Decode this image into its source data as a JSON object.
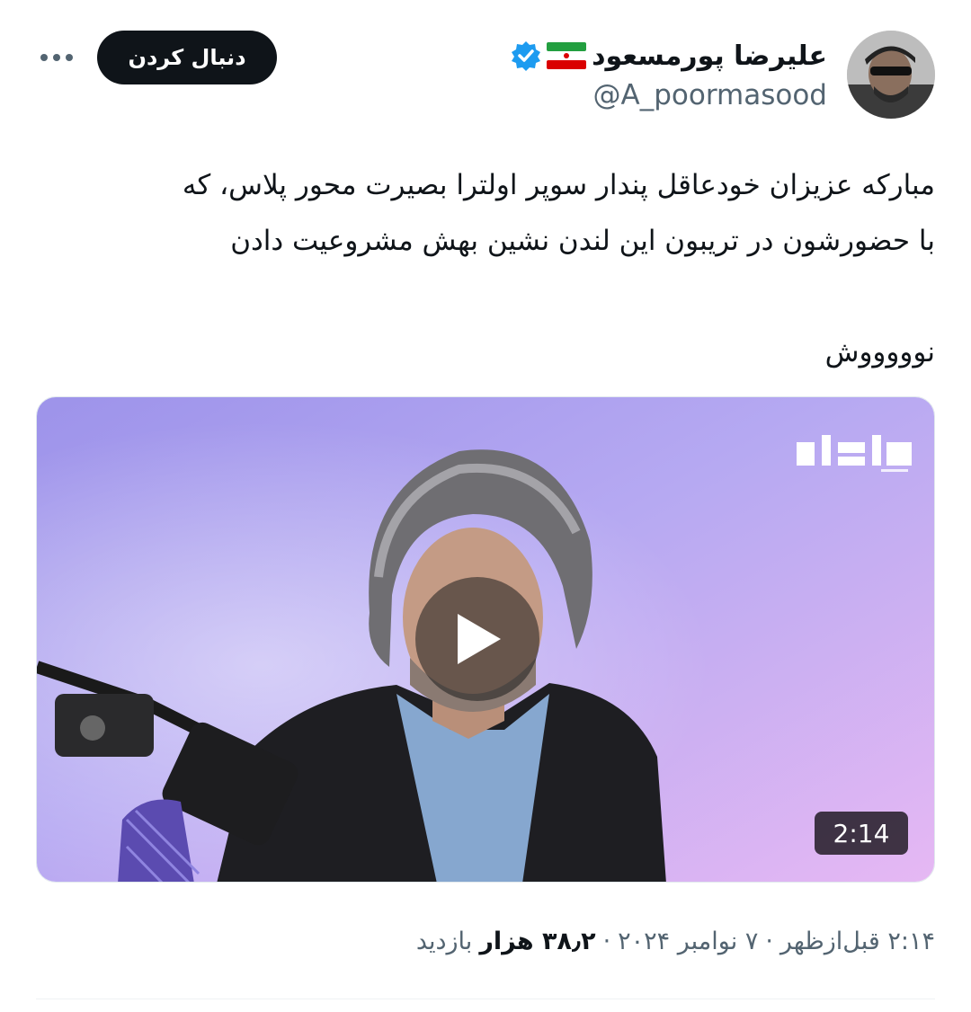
{
  "author": {
    "display_name": "علیرضا پورمسعود",
    "handle": "@A_poormasood",
    "flag_icon": "iran-flag-icon",
    "verified_icon": "verified-badge-icon"
  },
  "header": {
    "follow_label": "دنبال کردن",
    "more_icon": "more-options-icon"
  },
  "tweet": {
    "line_1": "مبارکه عزیزان خودعاقل پندار سوپر اولترا بصیرت محور پلاس، که",
    "line_2": "با حضورشون در تریبون این لندن نشین بهش مشروعیت دادن",
    "line_3": "نوووووش"
  },
  "media": {
    "type": "video",
    "duration": "2:14",
    "play_icon": "play-icon",
    "watermark_icon": "channel-logo-icon"
  },
  "meta": {
    "time": "۲:۱۴ قبل‌ازظهر",
    "date": "۷ نوامبر ۲۰۲۴",
    "separator": "·",
    "views_count": "۳۸٫۲ هزار",
    "views_label": "بازدید"
  },
  "colors": {
    "text_primary": "#0f1419",
    "text_secondary": "#536471",
    "verified": "#1d9bf0",
    "follow_button_bg": "#0f1419"
  }
}
